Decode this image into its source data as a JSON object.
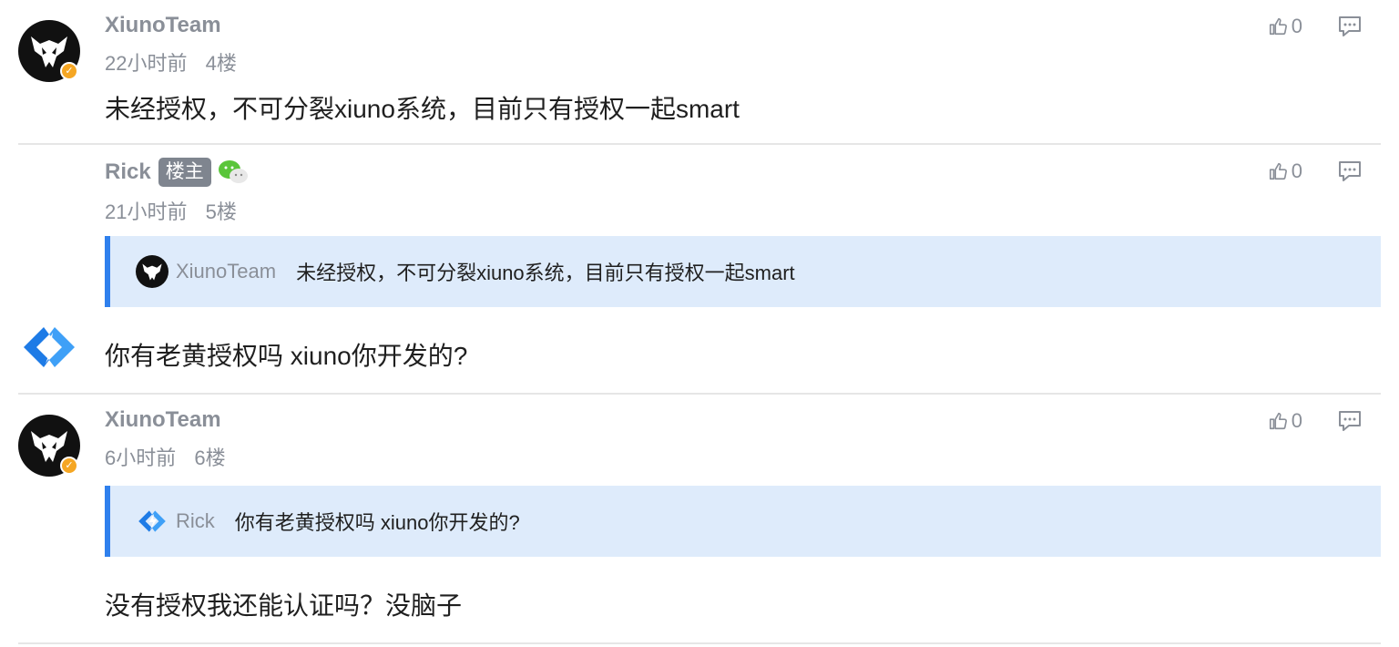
{
  "posts": [
    {
      "username": "XiunoTeam",
      "time": "22小时前",
      "floor": "4楼",
      "likes": "0",
      "content": "未经授权，不可分裂xiuno系统，目前只有授权一起smart"
    },
    {
      "username": "Rick",
      "owner_badge": "楼主",
      "time": "21小时前",
      "floor": "5楼",
      "likes": "0",
      "quote": {
        "username": "XiunoTeam",
        "text": "未经授权，不可分裂xiuno系统，目前只有授权一起smart"
      },
      "content": "你有老黄授权吗 xiuno你开发的?"
    },
    {
      "username": "XiunoTeam",
      "time": "6小时前",
      "floor": "6楼",
      "likes": "0",
      "quote": {
        "username": "Rick",
        "text": "你有老黄授权吗 xiuno你开发的?"
      },
      "content": "没有授权我还能认证吗？没脑子"
    }
  ],
  "icons": {
    "like": "thumbs-up-icon",
    "reply": "comment-icon",
    "wechat": "wechat-icon",
    "verified": "verified-badge-icon"
  },
  "colors": {
    "quote_bg": "#deebfb",
    "quote_border": "#2f80ed",
    "verified": "#f5a623",
    "muted": "#8a8f98"
  }
}
